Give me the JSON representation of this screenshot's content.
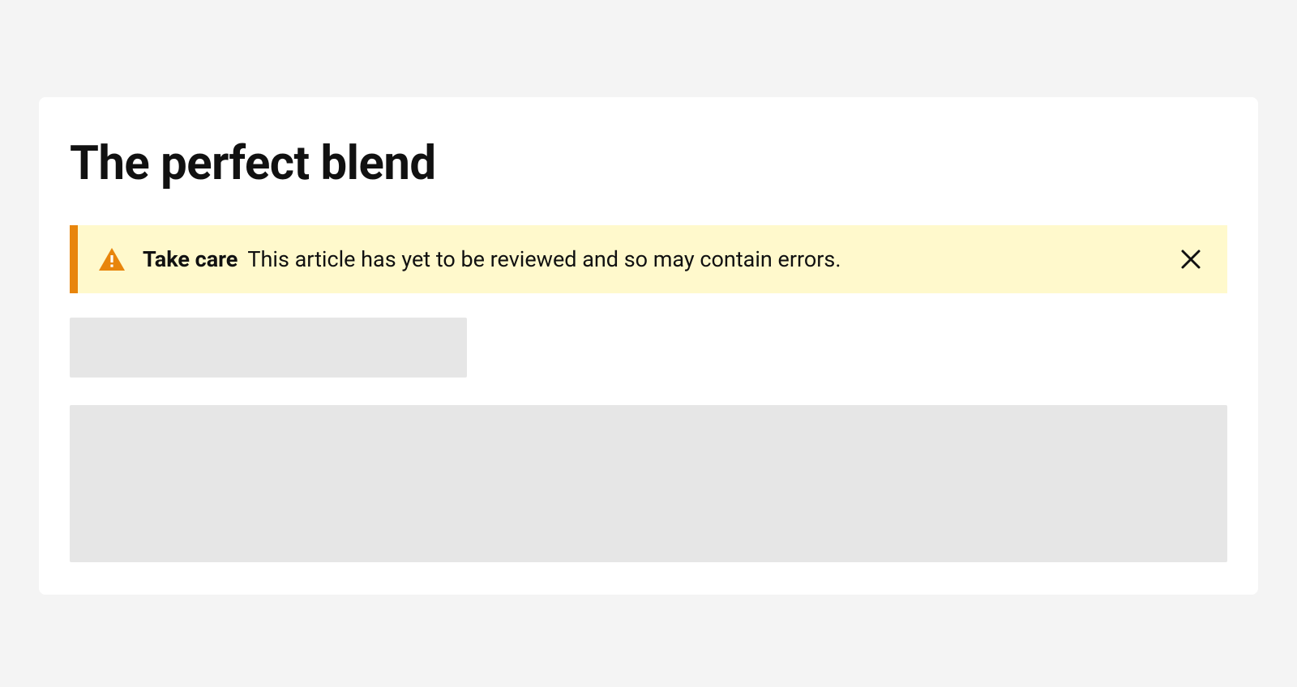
{
  "page": {
    "title": "The perfect blend"
  },
  "alert": {
    "title": "Take care",
    "message": "This article has yet to be reviewed and so may contain errors.",
    "accent_color": "#e8850c",
    "bg_color": "#fff9cc"
  }
}
